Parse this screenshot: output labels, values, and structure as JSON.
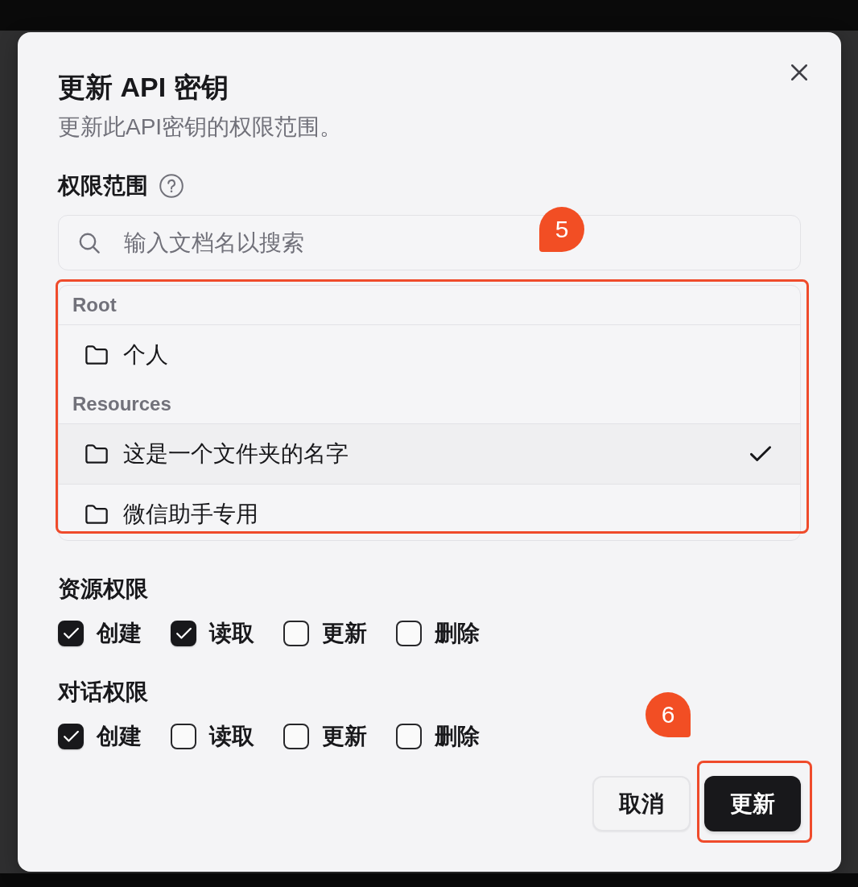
{
  "dialog": {
    "title": "更新 API 密钥",
    "subtitle": "更新此API密钥的权限范围。"
  },
  "scope": {
    "label": "权限范围",
    "search": {
      "placeholder": "输入文档名以搜索"
    },
    "groups": [
      {
        "heading": "Root",
        "items": [
          {
            "name": "个人",
            "selected": false
          }
        ]
      },
      {
        "heading": "Resources",
        "items": [
          {
            "name": "这是一个文件夹的名字",
            "selected": true
          },
          {
            "name": "微信助手专用",
            "selected": false
          }
        ]
      }
    ]
  },
  "permissions": [
    {
      "label": "资源权限",
      "options": [
        {
          "label": "创建",
          "checked": true
        },
        {
          "label": "读取",
          "checked": true
        },
        {
          "label": "更新",
          "checked": false
        },
        {
          "label": "删除",
          "checked": false
        }
      ]
    },
    {
      "label": "对话权限",
      "options": [
        {
          "label": "创建",
          "checked": true
        },
        {
          "label": "读取",
          "checked": false
        },
        {
          "label": "更新",
          "checked": false
        },
        {
          "label": "删除",
          "checked": false
        }
      ]
    }
  ],
  "buttons": [
    {
      "label": "取消",
      "kind": "secondary"
    },
    {
      "label": "更新",
      "kind": "primary"
    }
  ],
  "annotations": [
    {
      "label": "5",
      "kind": "list"
    },
    {
      "label": "6",
      "kind": "button"
    }
  ]
}
